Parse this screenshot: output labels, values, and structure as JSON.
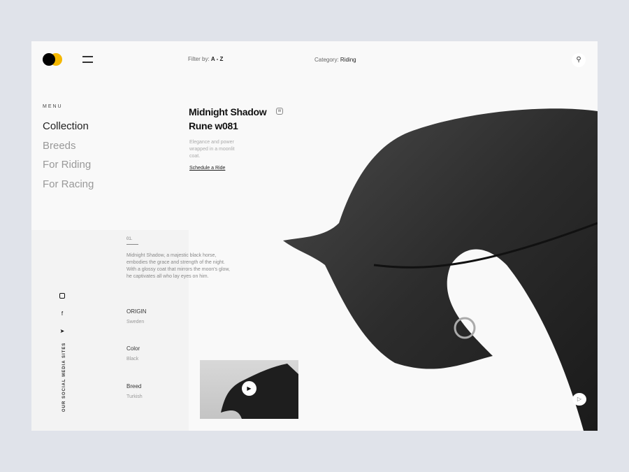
{
  "header": {
    "filter_label": "Filter by:",
    "filter_value": "A - Z",
    "category_label": "Category:",
    "category_value": "Riding"
  },
  "menu": {
    "label": "MENU",
    "items": [
      {
        "label": "Collection",
        "active": true
      },
      {
        "label": "Breeds"
      },
      {
        "label": "For Riding"
      },
      {
        "label": "For Racing"
      }
    ]
  },
  "product": {
    "title": "Midnight Shadow Rune w081",
    "badge": "W",
    "tagline": "Elegance and power wrapped in a moonlit coat.",
    "cta": "Schedule a Ride"
  },
  "details": {
    "number": "01.",
    "description": "Midnight Shadow, a majestic black horse, embodies the grace and strength of the night. With a glossy coat that mirrors the moon's glow, he captivates all who lay eyes on him.",
    "specs": [
      {
        "label": "ORIGIN",
        "value": "Sweden"
      },
      {
        "label": "Color",
        "value": "Black"
      },
      {
        "label": "Breed",
        "value": "Turkish"
      }
    ]
  },
  "social": {
    "label": "OUR SOCIAL MEDIA SITES",
    "icons": [
      "instagram-icon",
      "facebook-icon",
      "twitter-icon"
    ]
  },
  "colors": {
    "accent": "#f5b800",
    "background": "#e0e3ea"
  }
}
